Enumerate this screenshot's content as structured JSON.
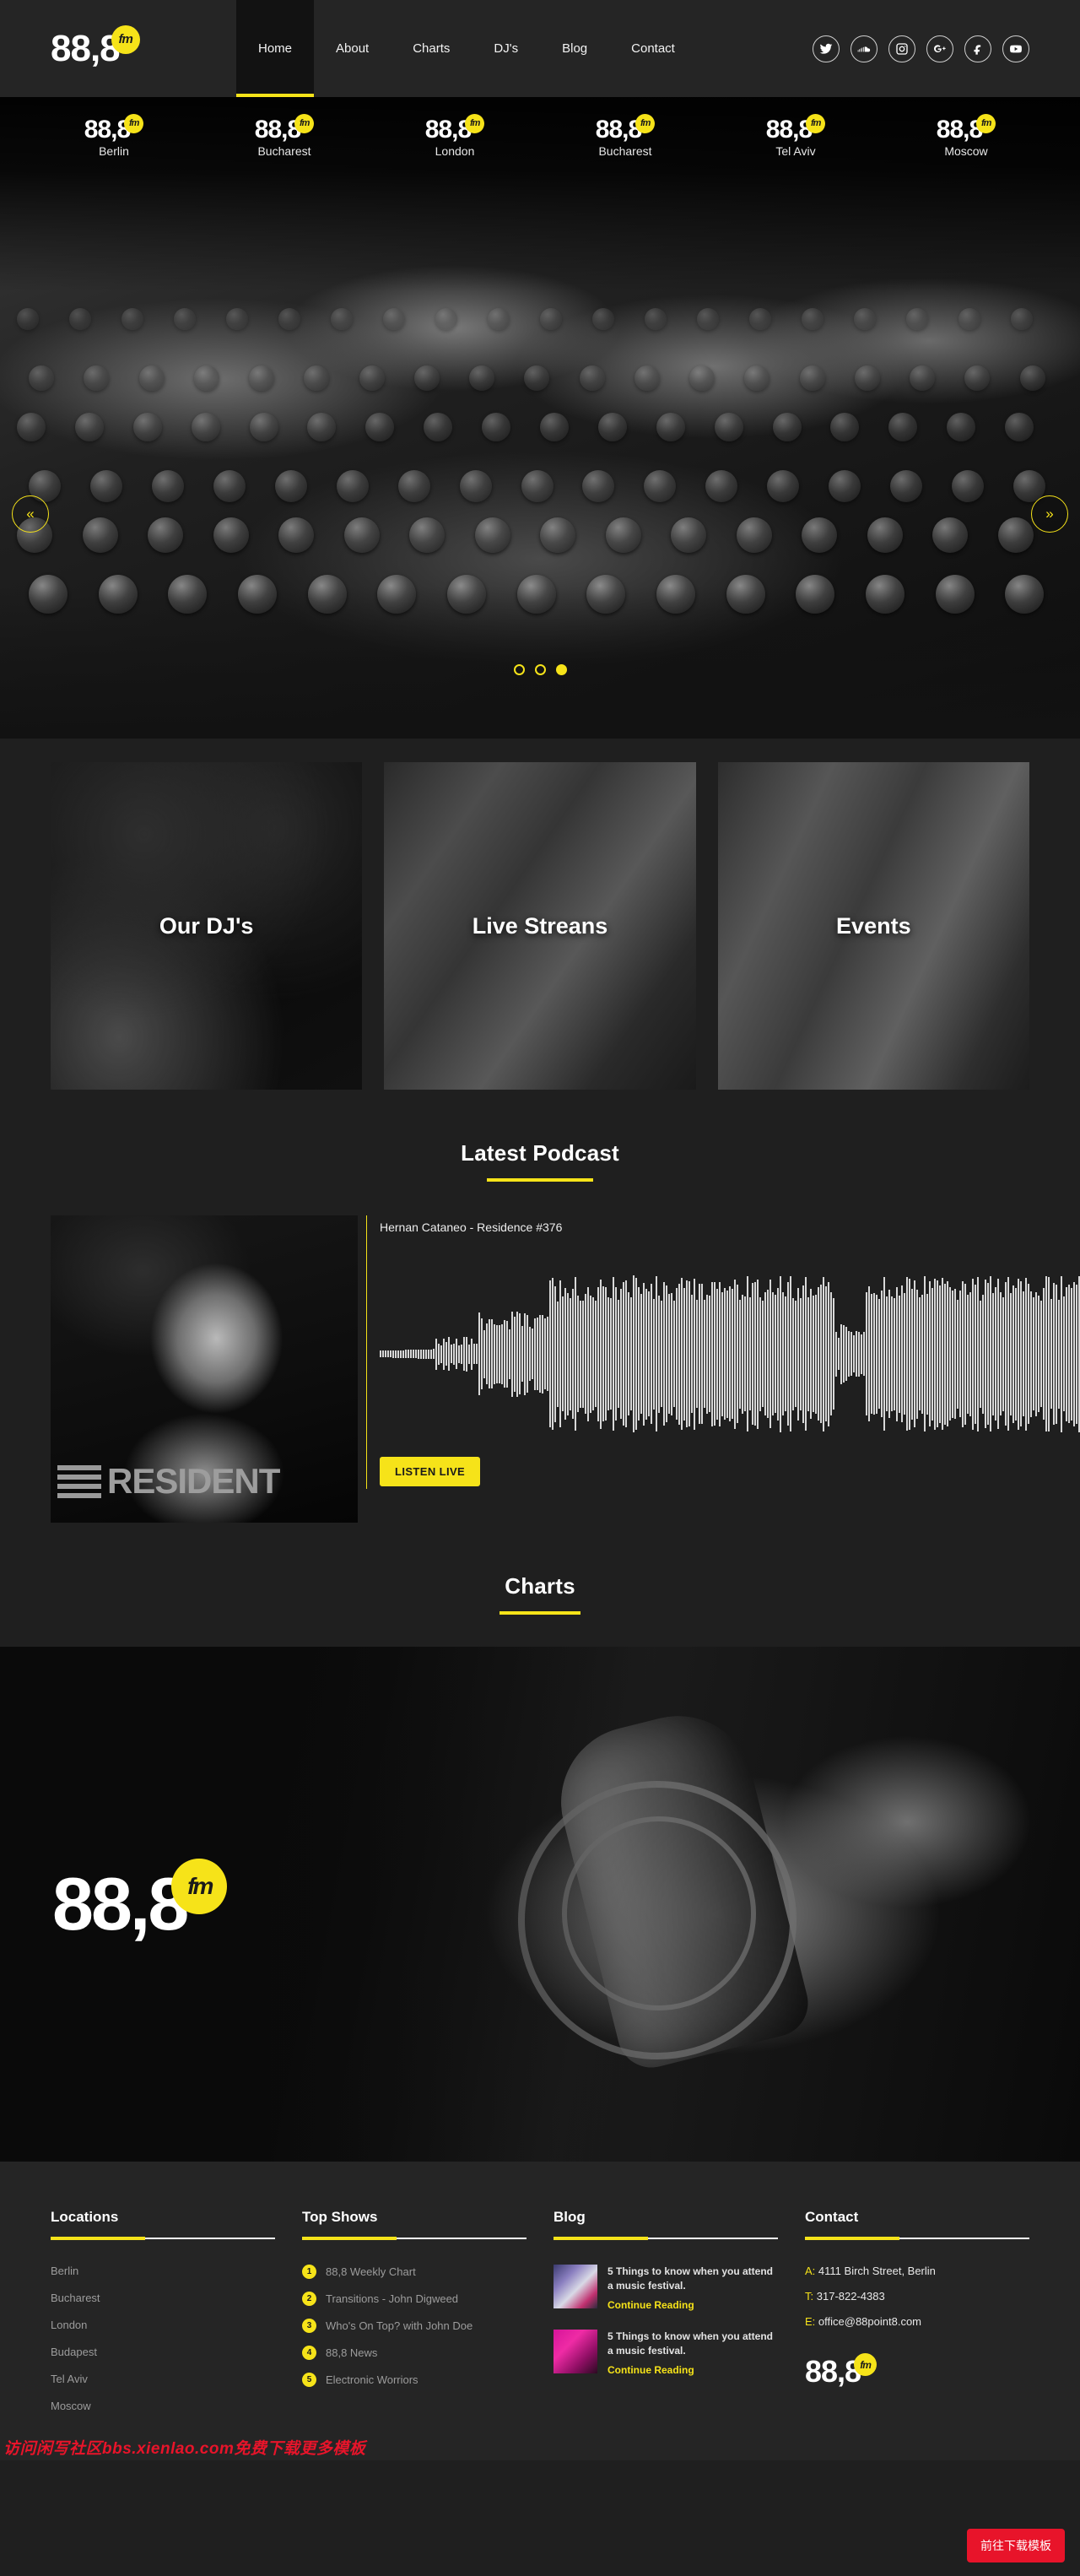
{
  "brand": {
    "number": "88,8",
    "badge": "fm"
  },
  "nav": {
    "items": [
      {
        "label": "Home",
        "active": true
      },
      {
        "label": "About",
        "active": false
      },
      {
        "label": "Charts",
        "active": false
      },
      {
        "label": "DJ's",
        "active": false
      },
      {
        "label": "Blog",
        "active": false
      },
      {
        "label": "Contact",
        "active": false
      }
    ]
  },
  "socials": [
    {
      "name": "twitter-icon"
    },
    {
      "name": "soundcloud-icon"
    },
    {
      "name": "instagram-icon"
    },
    {
      "name": "google-plus-icon"
    },
    {
      "name": "facebook-icon"
    },
    {
      "name": "youtube-icon"
    }
  ],
  "hero": {
    "cities": [
      {
        "freq": "88,8",
        "badge": "fm",
        "name": "Berlin"
      },
      {
        "freq": "88,8",
        "badge": "fm",
        "name": "Bucharest"
      },
      {
        "freq": "88,8",
        "badge": "fm",
        "name": "London"
      },
      {
        "freq": "88,8",
        "badge": "fm",
        "name": "Bucharest"
      },
      {
        "freq": "88,8",
        "badge": "fm",
        "name": "Tel Aviv"
      },
      {
        "freq": "88,8",
        "badge": "fm",
        "name": "Moscow"
      }
    ],
    "prev_arrow": "«",
    "next_arrow": "»",
    "dots": [
      {
        "active": false
      },
      {
        "active": false
      },
      {
        "active": true
      }
    ]
  },
  "cards": [
    {
      "label": "Our DJ's"
    },
    {
      "label": "Live Streans"
    },
    {
      "label": "Events"
    }
  ],
  "podcast": {
    "heading": "Latest Podcast",
    "track_title": "Hernan Cataneo - Residence #376",
    "artwork_word": "RESIDENT",
    "button_label": "LISTEN LIVE"
  },
  "charts": {
    "heading": "Charts",
    "logo_number": "88,8",
    "logo_badge": "fm"
  },
  "footer": {
    "locations": {
      "title": "Locations",
      "items": [
        "Berlin",
        "Bucharest",
        "London",
        "Budapest",
        "Tel Aviv",
        "Moscow"
      ]
    },
    "top_shows": {
      "title": "Top Shows",
      "items": [
        {
          "num": "1",
          "label": "88,8 Weekly Chart"
        },
        {
          "num": "2",
          "label": "Transitions - John Digweed"
        },
        {
          "num": "3",
          "label": "Who's On Top? with John Doe"
        },
        {
          "num": "4",
          "label": "88,8 News"
        },
        {
          "num": "5",
          "label": "Electronic Worriors"
        }
      ]
    },
    "blog": {
      "title": "Blog",
      "posts": [
        {
          "text": "5 Things to know when you attend a music festival.",
          "link": "Continue Reading"
        },
        {
          "text": "5 Things to know when you attend a music festival.",
          "link": "Continue Reading"
        }
      ]
    },
    "contact": {
      "title": "Contact",
      "address_label": "A:",
      "address": "4111 Birch Street, Berlin",
      "phone_label": "T:",
      "phone": "317-822-4383",
      "email_label": "E:",
      "email": "office@88point8.com",
      "logo_number": "88,8",
      "logo_badge": "fm"
    }
  },
  "overlay": {
    "download_button": "前往下载模板",
    "watermark": "访问闲写社区bbs.xienlao.com免费下载更多模板"
  },
  "colors": {
    "accent": "#f6e319",
    "bg": "#1f1f1f",
    "header": "#252525",
    "danger": "#e8142a"
  }
}
